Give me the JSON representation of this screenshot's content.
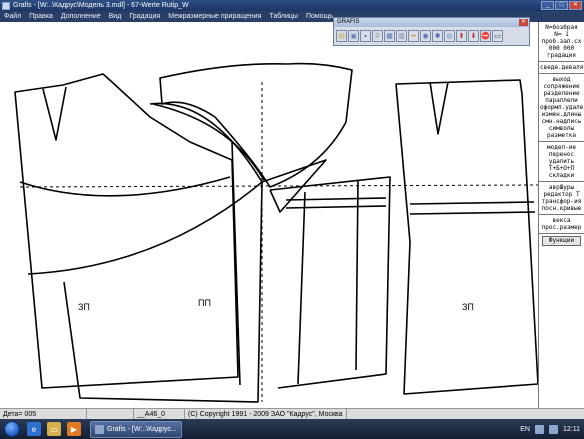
{
  "window": {
    "title": "Grafis - [W:..\\Кадрус\\Модель 3.mdl] - 67-Werte Rutip_W",
    "controls": [
      "_",
      "□",
      "✕"
    ]
  },
  "menu": {
    "items": [
      "Файл",
      "Правка",
      "Дополнение",
      "Вид",
      "Градация",
      "Межразмерные приращения",
      "Таблицы",
      "Помощь"
    ]
  },
  "toolbar": {
    "title": "GRAFIS",
    "close": "✕",
    "icons": [
      {
        "name": "open-icon",
        "glyph": "▤",
        "color": "#c9a64a"
      },
      {
        "name": "open-model-icon",
        "glyph": "▣",
        "color": "#6b7fb0"
      },
      {
        "name": "save-icon",
        "glyph": "▪",
        "color": "#3b5aa8"
      },
      {
        "name": "search-icon",
        "glyph": "⚲",
        "color": "#8c8c8c"
      },
      {
        "name": "table-icon",
        "glyph": "▦",
        "color": "#5070b0"
      },
      {
        "name": "grid-icon",
        "glyph": "▥",
        "color": "#708090"
      },
      {
        "name": "ruler-icon",
        "glyph": "━",
        "color": "#b89030"
      },
      {
        "name": "zoom-icon",
        "glyph": "◉",
        "color": "#4a6ab0"
      },
      {
        "name": "settings-icon",
        "glyph": "✱",
        "color": "#4a6ab0"
      },
      {
        "name": "export-icon",
        "glyph": "◎",
        "color": "#4a6ab0"
      },
      {
        "name": "upload-icon",
        "glyph": "⬆",
        "color": "#c03030"
      },
      {
        "name": "download-icon",
        "glyph": "⬇",
        "color": "#c03030"
      },
      {
        "name": "stop-icon",
        "glyph": "⛔",
        "color": "#d02020"
      },
      {
        "name": "monitor-icon",
        "glyph": "▭",
        "color": "#2a5a6a"
      }
    ]
  },
  "pieces": {
    "left_label": "ЗП",
    "middle_label": "ПП",
    "right_label": "ЗП"
  },
  "panel": {
    "block1": [
      "N=бозбрая",
      "N= 1",
      "проб.зап.сх",
      "000 000",
      "градация"
    ],
    "block2": [
      "сведе.деваля"
    ],
    "block3": [
      "выход",
      "сопряжение",
      "разделение",
      "параллели",
      "оформл.удаление",
      "измен.длины",
      "смн.надпись",
      "символы",
      "разметка"
    ],
    "block4": [
      "модел-ие",
      "перенос",
      "удалить",
      "Т+Б+О+П",
      "складки"
    ],
    "block5": [
      "аврШуры",
      "редактор T",
      "трансфор-ия",
      "посн.кривые"
    ],
    "block6": [
      "векса",
      "прос.размер"
    ],
    "button": "Функции"
  },
  "status": {
    "detail": "Дета= 005",
    "seg2": "",
    "coords": "__А46_0",
    "copyright": "(C) Copyright 1991 - 2009 ЗАО \"Кадрус\", Москва"
  },
  "taskbar": {
    "app_button": "Grafis - [W:..\\Кадрус...",
    "lang": "EN",
    "clock": "12:11"
  }
}
